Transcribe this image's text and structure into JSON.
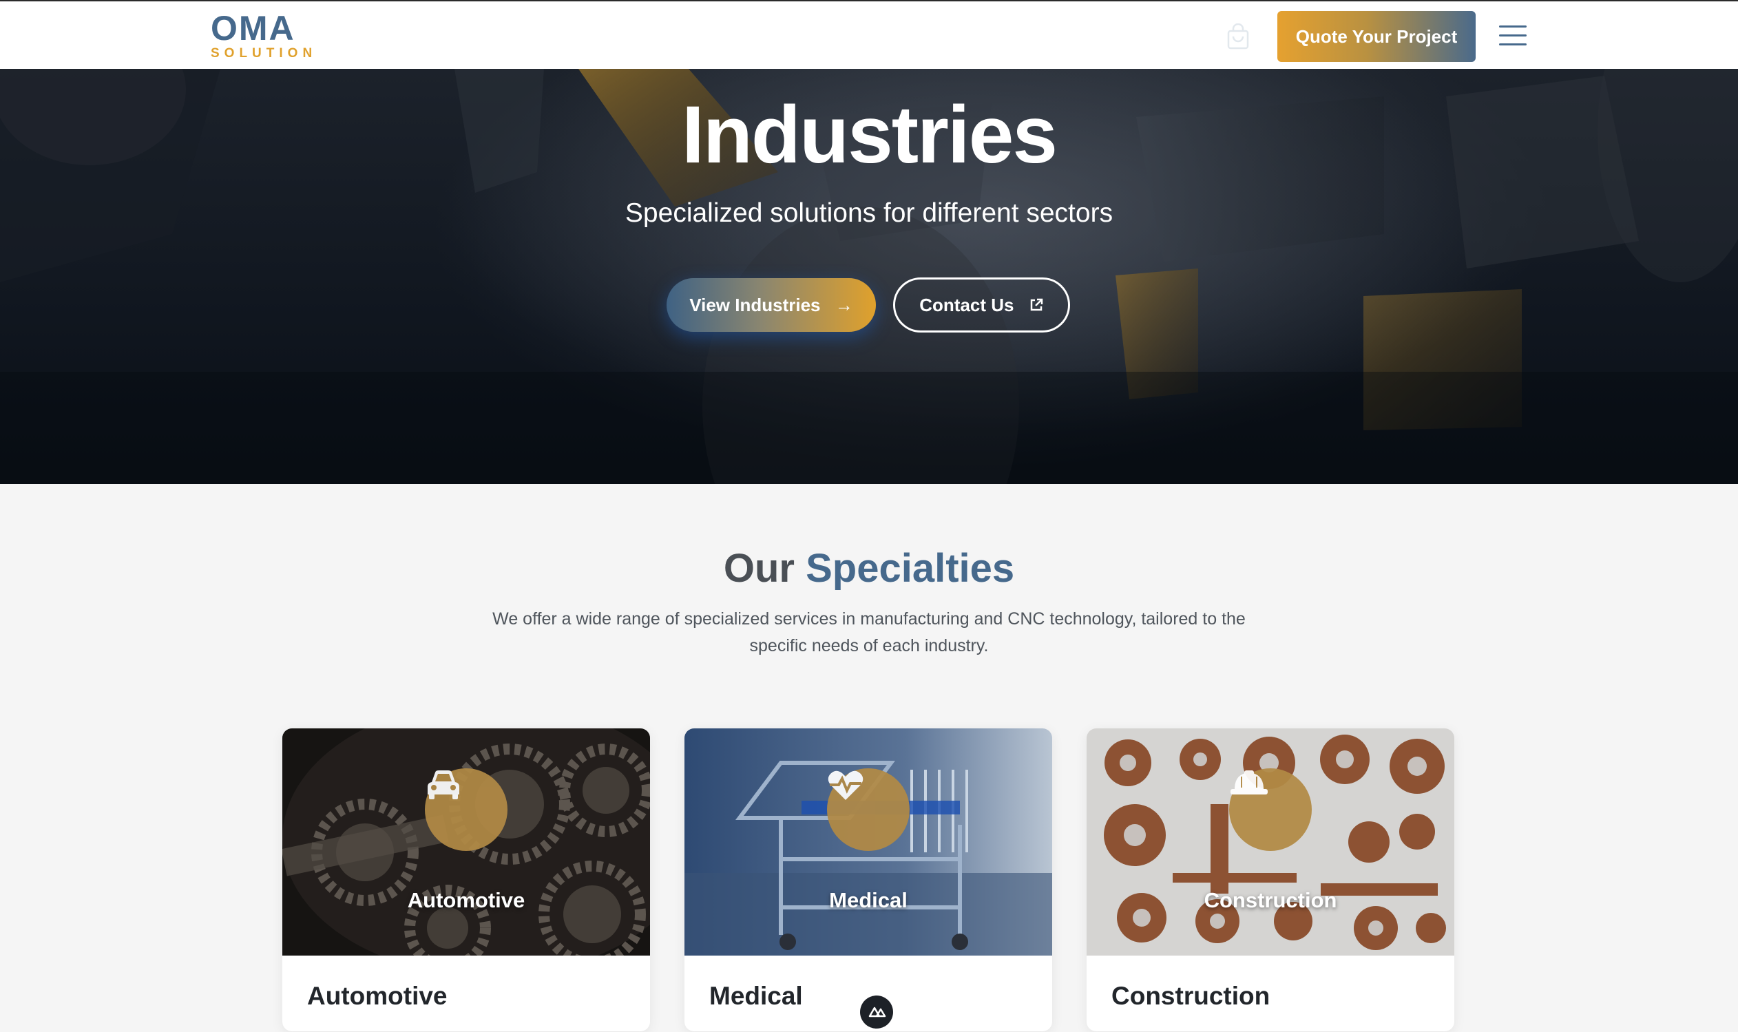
{
  "navbar": {
    "logo_main": "OMA",
    "logo_sub": "SOLUTION",
    "cart_icon": "shopping-bag-icon",
    "quote_button": "Quote Your Project",
    "menu_icon": "hamburger-menu-icon"
  },
  "hero": {
    "title": "Industries",
    "subtitle": "Specialized solutions for different sectors",
    "view_button": "View Industries",
    "view_icon": "arrow-right-icon",
    "contact_button": "Contact Us",
    "contact_icon": "external-link-icon"
  },
  "specialties": {
    "title_part1": "Our",
    "title_part2": "Specialties",
    "description": "We offer a wide range of specialized services in manufacturing and CNC technology, tailored to the specific needs of each industry.",
    "cards": [
      {
        "overlay_label": "Automotive",
        "title": "Automotive",
        "icon": "car-icon"
      },
      {
        "overlay_label": "Medical",
        "title": "Medical",
        "icon": "heart-pulse-icon"
      },
      {
        "overlay_label": "Construction",
        "title": "Construction",
        "icon": "hard-hat-icon"
      }
    ]
  },
  "floating": {
    "icon": "nuxt-logo-icon"
  },
  "colors": {
    "brand_blue": "#46698c",
    "brand_gold": "#e0a12c",
    "hero_bg": "#10161f",
    "page_bg": "#f5f5f5"
  }
}
